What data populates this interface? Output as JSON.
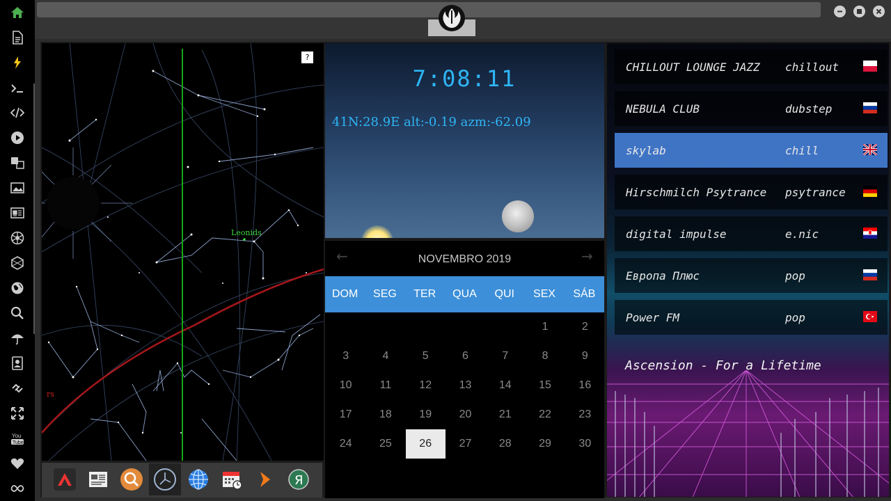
{
  "rail": {
    "icons": [
      "home-icon",
      "document-icon",
      "lightning-icon",
      "terminal-icon",
      "code-icon",
      "play-icon",
      "translate-icon",
      "image-icon",
      "news-icon",
      "aperture-icon",
      "hexagon-icon",
      "globe-icon",
      "search-icon",
      "umbrella-icon",
      "contact-icon",
      "link-icon",
      "fullscreen-icon",
      "youtube-icon",
      "heart-icon",
      "infinity-icon"
    ],
    "accent": "#4caf50"
  },
  "topbar": {
    "emblem": "rebel-alliance-icon"
  },
  "starmap": {
    "help_label": "?",
    "meteor_label": "Leonids",
    "edge_label": "rs"
  },
  "sky": {
    "time": "7:08:11",
    "coords": "41N:28.9E  alt:-0.19 azm:-62.09"
  },
  "calendar": {
    "month": "NOVEMBRO 2019",
    "prev": "←",
    "next": "→",
    "weekdays": [
      "DOM",
      "SEG",
      "TER",
      "QUA",
      "QUI",
      "SEX",
      "SÁB"
    ],
    "weeks": [
      [
        "",
        "",
        "",
        "",
        "",
        "1",
        "2"
      ],
      [
        "3",
        "4",
        "5",
        "6",
        "7",
        "8",
        "9"
      ],
      [
        "10",
        "11",
        "12",
        "13",
        "14",
        "15",
        "16"
      ],
      [
        "17",
        "18",
        "19",
        "20",
        "21",
        "22",
        "23"
      ],
      [
        "24",
        "25",
        "26",
        "27",
        "28",
        "29",
        "30"
      ]
    ],
    "today": "26",
    "header_color": "#3d8fd9"
  },
  "radio": {
    "stations": [
      {
        "name": "CHILLOUT LOUNGE JAZZ",
        "genre": "chillout",
        "flag": "poland-flag"
      },
      {
        "name": "NEBULA CLUB",
        "genre": "dubstep",
        "flag": "russia-flag"
      },
      {
        "name": "skylab",
        "genre": "chill",
        "flag": "uk-flag",
        "active": true
      },
      {
        "name": "Hirschmilch Psytrance",
        "genre": "psytrance",
        "flag": "germany-flag"
      },
      {
        "name": "digital impulse",
        "genre": "e.nic",
        "flag": "croatia-flag"
      },
      {
        "name": "Европа Плюс",
        "genre": "pop",
        "flag": "russia-flag"
      },
      {
        "name": "Power FM",
        "genre": "pop",
        "flag": "turkey-flag"
      }
    ],
    "now_playing": "Ascension - For a Lifetime",
    "active_color": "#3f74c4"
  },
  "dock": {
    "icons": [
      "app-launcher-icon",
      "news-reader-icon",
      "search-app-icon",
      "clock-app-icon",
      "browser-globe-icon",
      "calendar-app-icon",
      "play-arrow-icon",
      "yandex-icon"
    ]
  }
}
